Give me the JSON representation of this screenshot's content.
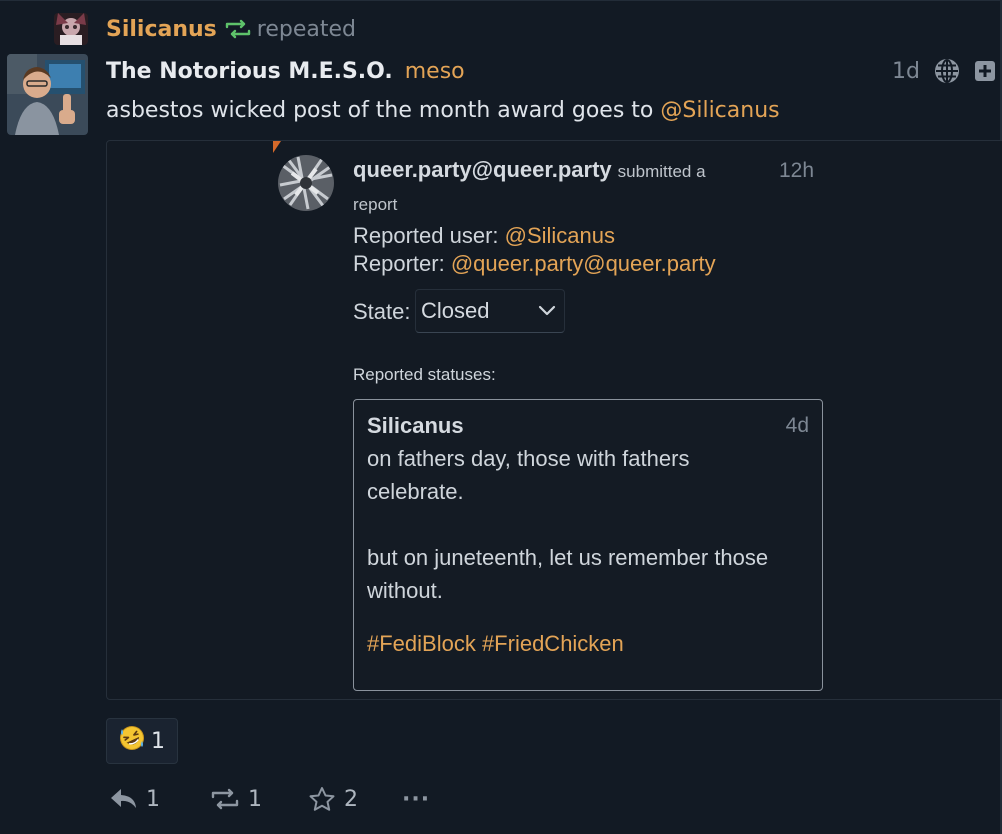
{
  "repeat": {
    "name": "Silicanus",
    "label": "repeated",
    "colors": {
      "name": "#e3a456",
      "icon": "#5ec26a"
    }
  },
  "post": {
    "author": "The Notorious M.E.S.O.",
    "handle": "meso",
    "time": "1d",
    "visibility_icon": "globe-icon",
    "expand_icon": "plus-square-icon",
    "text_before": "asbestos wicked post of the month award goes to ",
    "mention": "@Silicanus"
  },
  "embedded_report": {
    "reporter": "queer.party@queer.party",
    "submitted": "submitted a",
    "report_word": "report",
    "time": "12h",
    "reported_user_label": "Reported user: ",
    "reported_user": "@Silicanus",
    "reporter_label": "Reporter: ",
    "reporter_mention": "@queer.party@queer.party",
    "state_label": "State:",
    "state_value": "Closed",
    "reported_statuses_label": "Reported statuses:",
    "status": {
      "author": "Silicanus",
      "time": "4d",
      "body": "on fathers day, those with fathers\ncelebrate.\n\nbut on juneteenth, let us remember those\nwithout.",
      "hashtags": "#FediBlock #FriedChicken"
    }
  },
  "reaction": {
    "emoji": "🤣",
    "count": "1"
  },
  "actions": {
    "reply_count": "1",
    "repeat_count": "1",
    "favorite_count": "2",
    "more_label": "···"
  },
  "accent_color": "#e3a456"
}
